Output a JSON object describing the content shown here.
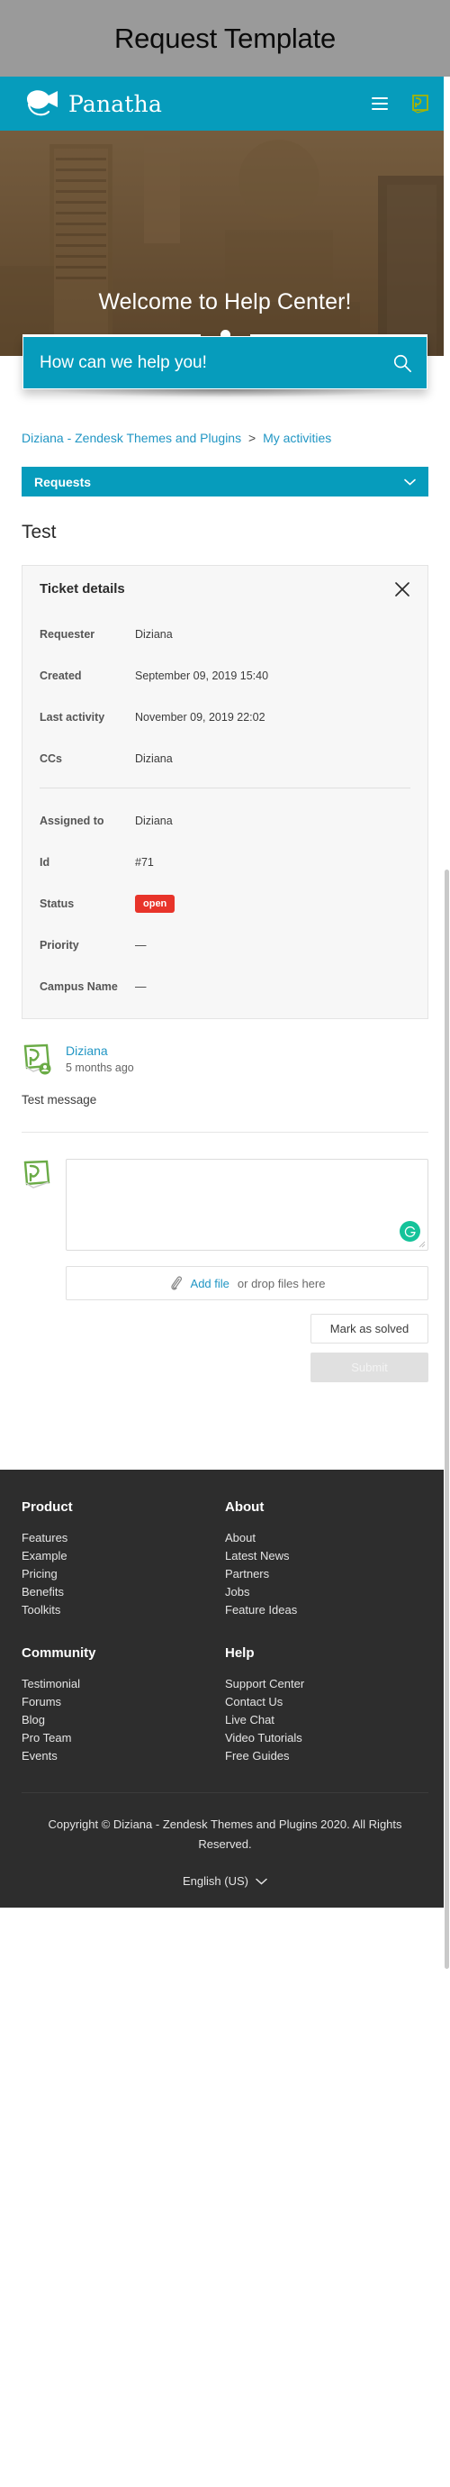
{
  "window": {
    "title": "Request Template"
  },
  "header": {
    "brand_name": "Panatha",
    "logo_icon": "panatha-fish-logo",
    "menu_icon": "hamburger-menu-icon",
    "user_icon": "user-avatar-icon"
  },
  "hero": {
    "title": "Welcome to Help Center!"
  },
  "search": {
    "placeholder": "How can we help you!",
    "value": "",
    "icon": "search-icon"
  },
  "breadcrumb": {
    "items": [
      {
        "label": "Diziana - Zendesk Themes and Plugins"
      },
      {
        "label": "My activities"
      }
    ],
    "separator": ">"
  },
  "requests_dropdown": {
    "label": "Requests",
    "icon": "chevron-down-icon"
  },
  "ticket": {
    "subject": "Test",
    "details_title": "Ticket details",
    "close_icon": "close-icon",
    "rows": [
      {
        "label": "Requester",
        "value": "Diziana",
        "type": "text"
      },
      {
        "label": "Created",
        "value": "September 09, 2019 15:40",
        "type": "text"
      },
      {
        "label": "Last activity",
        "value": "November 09, 2019 22:02",
        "type": "text"
      },
      {
        "label": "CCs",
        "value": "Diziana",
        "type": "text"
      }
    ],
    "rows2": [
      {
        "label": "Assigned to",
        "value": "Diziana",
        "type": "text"
      },
      {
        "label": "Id",
        "value": "#71",
        "type": "text"
      },
      {
        "label": "Status",
        "value": "open",
        "type": "badge",
        "badge_color": "#e8342a"
      },
      {
        "label": "Priority",
        "value": "—",
        "type": "text"
      },
      {
        "label": "Campus Name",
        "value": "—",
        "type": "text"
      }
    ]
  },
  "comment": {
    "author": "Diziana",
    "time": "5 months ago",
    "body": "Test message",
    "avatar_icon": "diziana-avatar-icon"
  },
  "reply": {
    "avatar_icon": "diziana-avatar-icon",
    "textarea_value": "",
    "textarea_placeholder": "",
    "grammarly_icon": "grammarly-icon",
    "attach": {
      "icon": "paperclip-icon",
      "link_label": "Add file",
      "rest_label": "or drop files here"
    },
    "mark_solved_label": "Mark as solved",
    "submit_label": "Submit"
  },
  "footer": {
    "columns": [
      {
        "title": "Product",
        "links": [
          "Features",
          "Example",
          "Pricing",
          "Benefits",
          "Toolkits"
        ]
      },
      {
        "title": "About",
        "links": [
          "About",
          "Latest News",
          "Partners",
          "Jobs",
          "Feature Ideas"
        ]
      },
      {
        "title": "Community",
        "links": [
          "Testimonial",
          "Forums",
          "Blog",
          "Pro Team",
          "Events"
        ]
      },
      {
        "title": "Help",
        "links": [
          "Support Center",
          "Contact Us",
          "Live Chat",
          "Video Tutorials",
          "Free Guides"
        ]
      }
    ],
    "copyright": "Copyright © Diziana - Zendesk Themes and Plugins 2020. All Rights Reserved.",
    "language": "English (US)",
    "language_icon": "chevron-down-icon"
  },
  "colors": {
    "brand": "#069cbc",
    "link": "#2196c4",
    "status_open": "#e8342a",
    "footer_bg": "#2d2d2d",
    "grammarly": "#15c39a"
  }
}
